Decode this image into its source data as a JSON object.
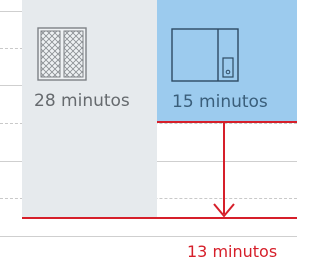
{
  "options": [
    {
      "time_label": "28 minutos",
      "icon": "double-door-grid-icon"
    },
    {
      "time_label": "15 minutos",
      "icon": "cabinet-with-handle-icon"
    }
  ],
  "saving": {
    "time_label": "13 minutos",
    "icon": "down-arrow-icon"
  },
  "colors": {
    "panel_grey": "#e6eaed",
    "panel_blue": "#9ccbee",
    "accent_red": "#d61f2a",
    "text_grey": "#666a6e",
    "text_blue": "#3a5e7a"
  }
}
